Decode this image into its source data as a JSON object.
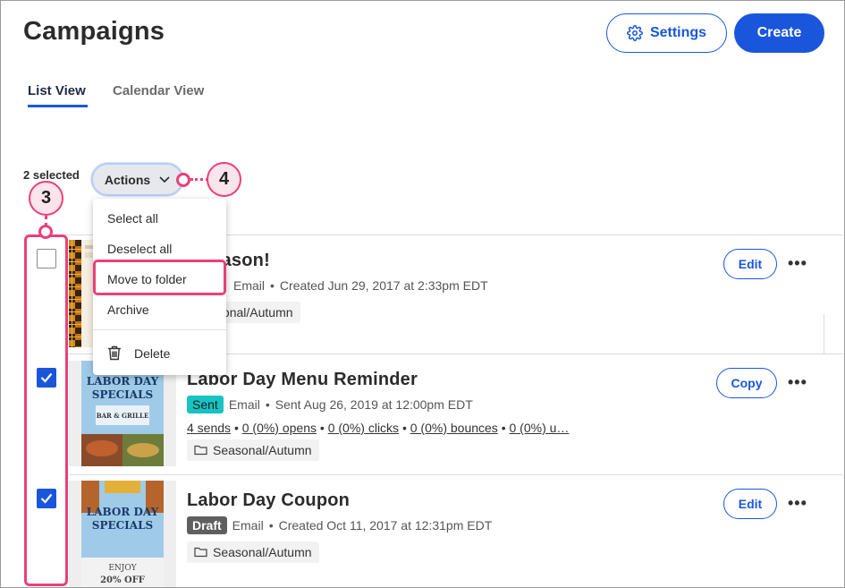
{
  "header": {
    "title": "Campaigns",
    "settings_label": "Settings",
    "create_label": "Create"
  },
  "tabs": [
    {
      "label": "List View",
      "active": true
    },
    {
      "label": "Calendar View",
      "active": false
    }
  ],
  "toolbar": {
    "selected_count": "2 selected",
    "actions_label": "Actions"
  },
  "actions_menu": {
    "items": [
      "Select all",
      "Deselect all",
      "Move to folder",
      "Archive",
      "Delete"
    ],
    "highlighted": "Move to folder"
  },
  "callouts": {
    "checkbox_step": "3",
    "actions_step": "4"
  },
  "campaigns": [
    {
      "title": "r Season!",
      "type": "Email",
      "meta": "Created Jun 29, 2017 at 2:33pm EDT",
      "folder": "Seasonal/Autumn",
      "checked": false,
      "action_label": "Edit"
    },
    {
      "title": "Labor Day Menu Reminder",
      "status": "Sent",
      "type": "Email",
      "meta": "Sent Aug 26, 2019 at 12:00pm EDT",
      "stats": {
        "sends": "4 sends",
        "opens": "0 (0%) opens",
        "clicks": "0 (0%) clicks",
        "bounces": "0 (0%) bounces",
        "more": "0 (0%) u…"
      },
      "folder": "Seasonal/Autumn",
      "checked": true,
      "action_label": "Copy",
      "thumb_text": {
        "line1": "LABOR DAY",
        "line2": "SPECIALS",
        "logo": "BAR & GRILLE"
      }
    },
    {
      "title": "Labor Day Coupon",
      "status": "Draft",
      "type": "Email",
      "meta": "Created Oct 11, 2017 at 12:31pm EDT",
      "folder": "Seasonal/Autumn",
      "checked": true,
      "action_label": "Edit",
      "thumb_text": {
        "line1": "LABOR DAY",
        "line2": "SPECIALS",
        "offer1": "ENJOY",
        "offer2": "20% OFF"
      }
    }
  ],
  "icons": {
    "settings": "gear-icon",
    "dropdown": "chevron-down-icon",
    "delete": "trash-icon",
    "folder": "folder-icon",
    "more": "more-horizontal-icon",
    "check": "check-icon"
  },
  "colors": {
    "brand_blue": "#1a56db",
    "callout_pink": "#e9417a",
    "sent_badge": "#17c3c3",
    "draft_badge": "#5f5f5f"
  }
}
